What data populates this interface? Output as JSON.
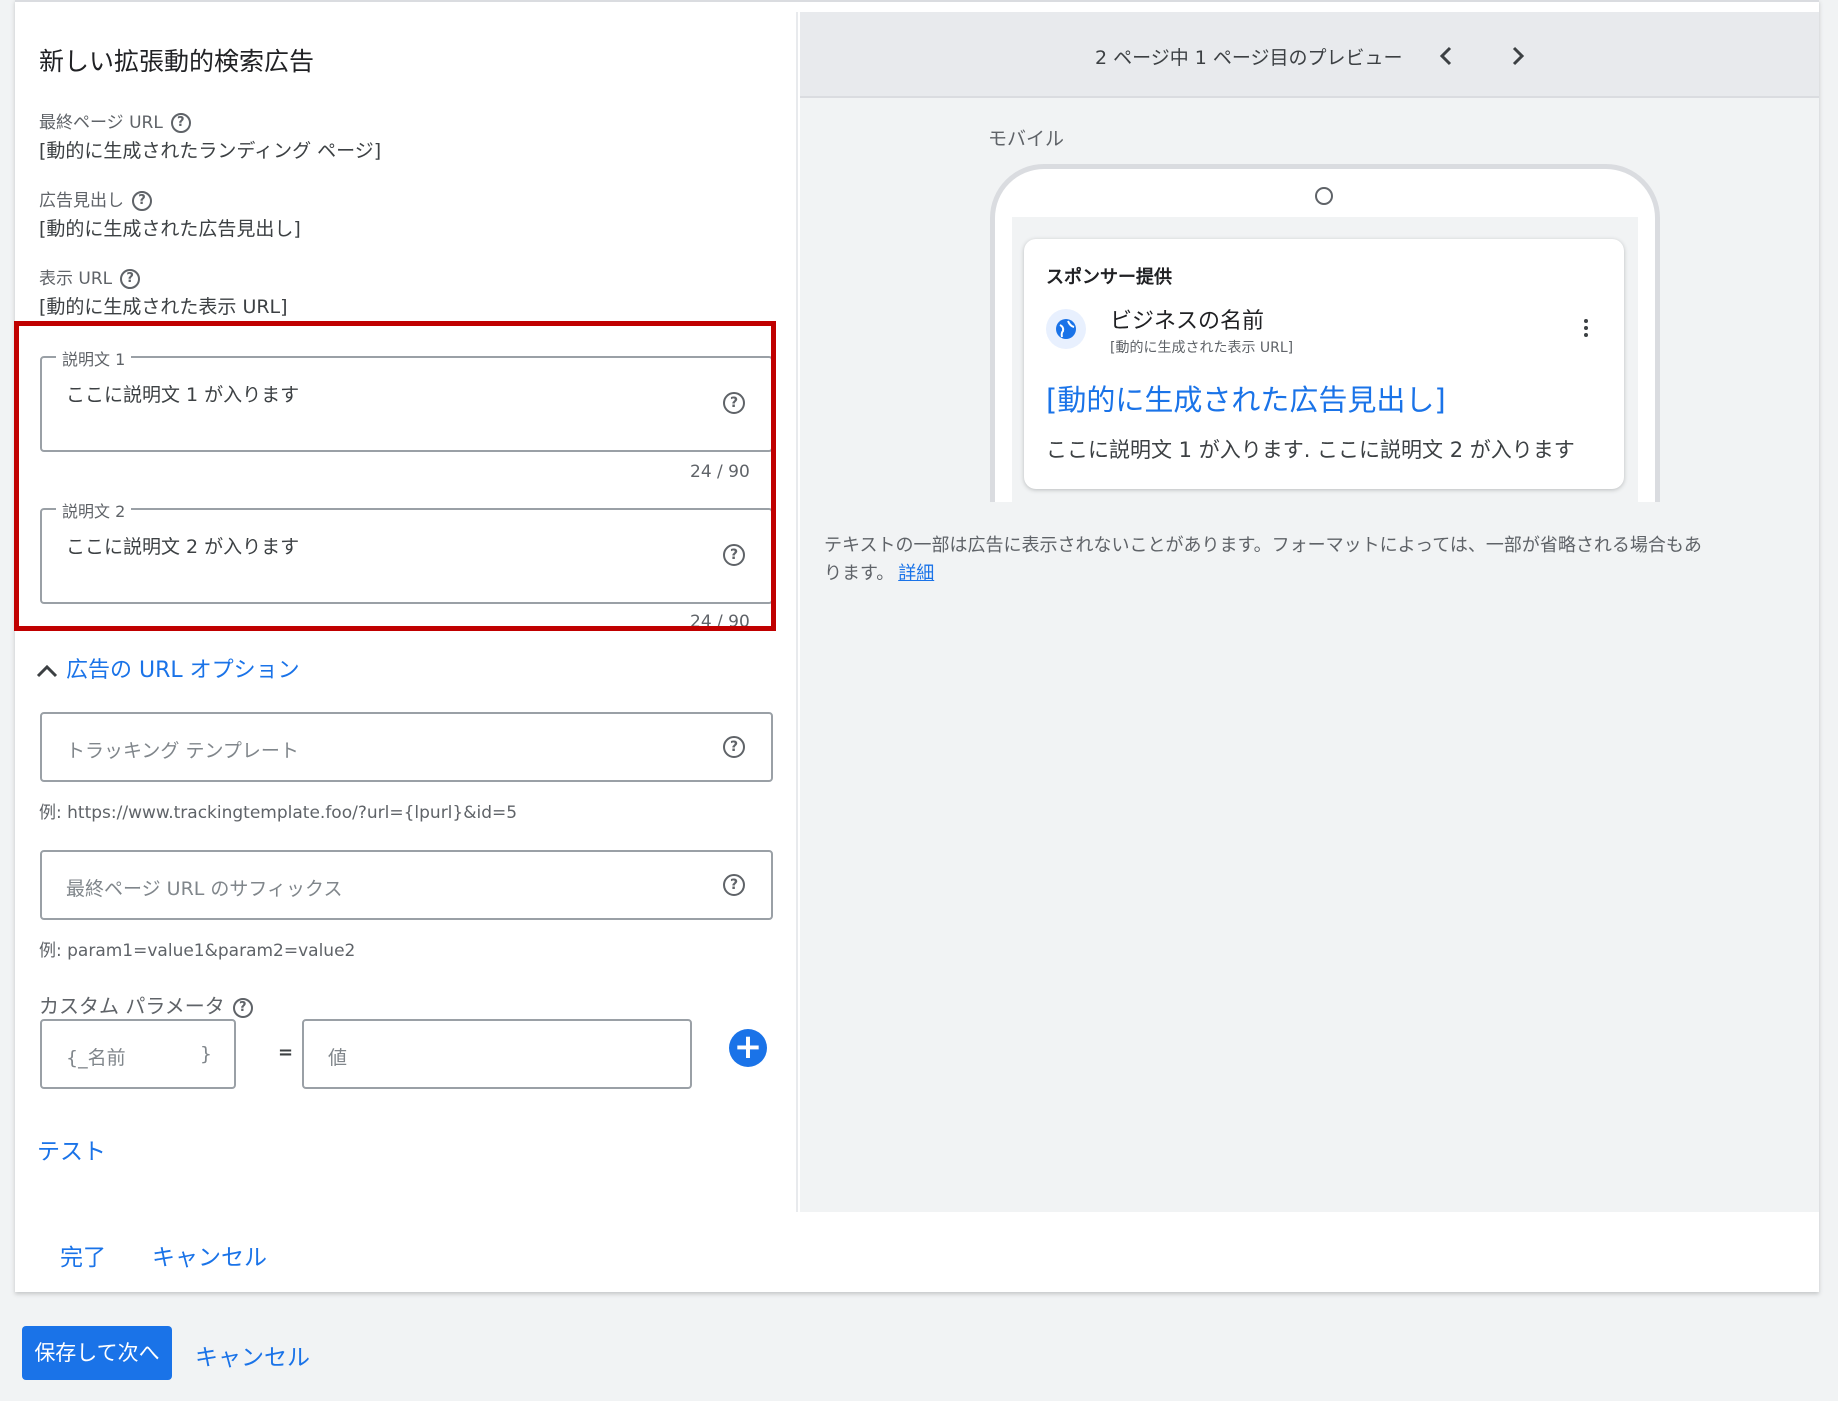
{
  "editor": {
    "title": "新しい拡張動的検索広告",
    "final_url_label": "最終ページ URL",
    "final_url_value": "[動的に生成されたランディング ページ]",
    "headline_label": "広告見出し",
    "headline_value": "[動的に生成された広告見出し]",
    "display_url_label": "表示 URL",
    "display_url_value": "[動的に生成された表示 URL]",
    "description1": {
      "label": "説明文 1",
      "value": "ここに説明文 1 が入ります",
      "counter": "24 / 90"
    },
    "description2": {
      "label": "説明文 2",
      "value": "ここに説明文 2 が入ります",
      "counter": "24 / 90"
    },
    "url_options_toggle": "広告の URL オプション",
    "tracking_template": {
      "placeholder": "トラッキング テンプレート",
      "hint": "例: https://www.trackingtemplate.foo/?url={lpurl}&id=5"
    },
    "final_url_suffix": {
      "placeholder": "最終ページ URL のサフィックス",
      "hint": "例: param1=value1&param2=value2"
    },
    "custom_params": {
      "label": "カスタム パラメータ",
      "name_placeholder": "{_名前",
      "name_suffix": "}",
      "equals": "=",
      "value_placeholder": "値"
    },
    "test_link": "テスト",
    "done_button": "完了",
    "cancel_button": "キャンセル"
  },
  "preview": {
    "pager_text": "2 ページ中 1 ページ目のプレビュー",
    "device_label": "モバイル",
    "ad": {
      "sponsor": "スポンサー提供",
      "business_name": "ビジネスの名前",
      "display_url": "[動的に生成された表示 URL]",
      "headline": "[動的に生成された広告見出し]",
      "description": "ここに説明文 1 が入ります. ここに説明文 2 が入ります"
    },
    "note": "テキストの一部は広告に表示されないことがあります。フォーマットによっては、一部が省略される場合もあ",
    "note_line2": "ります。",
    "note_link": "詳細"
  },
  "footer": {
    "save_next_button": "保存して次へ",
    "cancel_button": "キャンセル"
  },
  "colors": {
    "accent": "#1a73e8",
    "highlight": "#c00000"
  }
}
